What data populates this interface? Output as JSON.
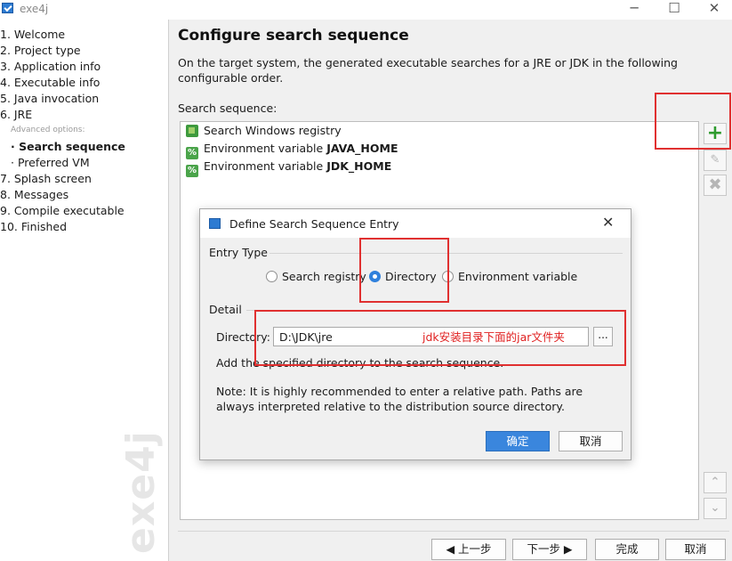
{
  "window": {
    "title": "exe4j",
    "minimize": "─",
    "maximize": "☐",
    "close": "✕"
  },
  "sidebar": {
    "items": [
      "1. Welcome",
      "2. Project type",
      "3. Application info",
      "4. Executable info",
      "5. Java invocation",
      "6. JRE",
      "Advanced options:",
      "· Search sequence",
      "· Preferred VM",
      "7. Splash screen",
      "8. Messages",
      "9. Compile executable",
      "10. Finished"
    ],
    "watermark": "exe4j"
  },
  "main": {
    "heading": "Configure search sequence",
    "description": "On the target system, the generated executable searches for a JRE or JDK in the following configurable order.",
    "sequence_label": "Search sequence:",
    "sequence": [
      {
        "icon": "registry-icon",
        "prefix": "Search Windows registry",
        "bold": ""
      },
      {
        "icon": "env-var-icon",
        "prefix": "Environment variable ",
        "bold": "JAVA_HOME"
      },
      {
        "icon": "env-var-icon",
        "prefix": "Environment variable ",
        "bold": "JDK_HOME"
      }
    ],
    "side_buttons": {
      "add": "+",
      "edit": "✎",
      "delete": "✖",
      "up": "⌃",
      "down": "⌄"
    }
  },
  "footer": {
    "back": "◀  上一步",
    "next": "下一步  ▶",
    "finish": "完成",
    "cancel": "取消"
  },
  "dialog": {
    "title": "Define Search Sequence Entry",
    "close": "✕",
    "entry_type_label": "Entry Type",
    "options": [
      "Search registry",
      "Directory",
      "Environment variable"
    ],
    "selected_option": "Directory",
    "detail_label": "Detail",
    "directory_label": "Directory:",
    "directory_value": "D:\\JDK\\jre",
    "annotation": "jdk安装目录下面的jar文件夹",
    "browse": "...",
    "help_text": "Add the specified directory to the search sequence.",
    "note": "Note: It is highly recommended to enter a relative path. Paths are always interpreted relative to the distribution source directory.",
    "ok": "确定",
    "cancel": "取消"
  },
  "colors": {
    "accent": "#3a86dd",
    "annotation_red": "#e03030",
    "add_green": "#2e9b2e"
  }
}
